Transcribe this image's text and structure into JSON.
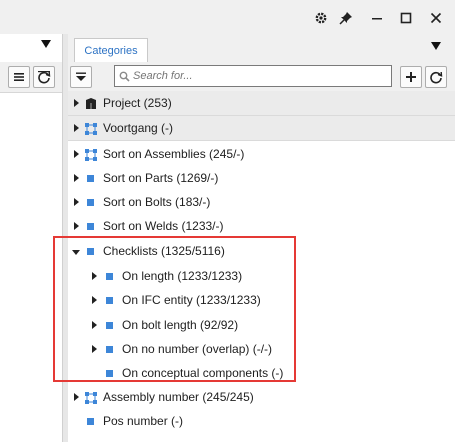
{
  "titlebar": {
    "icons": [
      "gear-icon",
      "pin-icon",
      "minimize-icon",
      "maximize-icon",
      "close-icon"
    ]
  },
  "tabs": [
    {
      "label": "Categories",
      "active": true
    }
  ],
  "search": {
    "placeholder": "Search for...",
    "value": ""
  },
  "tree": {
    "groups": [
      {
        "label": "Project (253)",
        "icon": "building-icon"
      },
      {
        "label": "Voortgang (-)",
        "icon": "nodes-icon"
      }
    ],
    "items": [
      {
        "label": "Sort on Assemblies (245/-)",
        "icon": "nodes-icon"
      },
      {
        "label": "Sort on Parts (1269/-)",
        "icon": "square-icon"
      },
      {
        "label": "Sort on Bolts (183/-)",
        "icon": "square-icon"
      },
      {
        "label": "Sort on Welds (1233/-)",
        "icon": "square-icon"
      },
      {
        "label": "Checklists (1325/5116)",
        "icon": "square-icon",
        "expanded": true
      },
      {
        "label": "On length (1233/1233)",
        "icon": "square-icon"
      },
      {
        "label": "On IFC entity (1233/1233)",
        "icon": "square-icon"
      },
      {
        "label": "On bolt length (92/92)",
        "icon": "square-icon"
      },
      {
        "label": "On no number (overlap) (-/-)",
        "icon": "square-icon"
      },
      {
        "label": "On conceptual components (-)",
        "icon": "square-icon"
      },
      {
        "label": "Assembly number (245/245)",
        "icon": "nodes-icon"
      },
      {
        "label": "Pos number (-)",
        "icon": "square-icon"
      }
    ]
  },
  "colors": {
    "accent": "#3d86d8",
    "highlight": "#e53935",
    "tab_text": "#2d73c4"
  }
}
